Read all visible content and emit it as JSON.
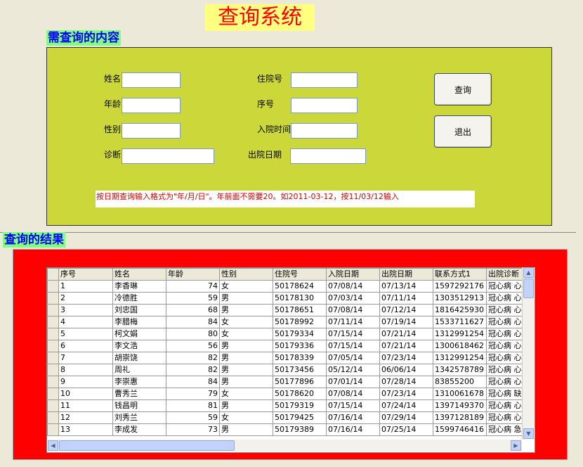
{
  "title": "查询系统",
  "query_section_label": "需查询的内容",
  "result_section_label": "查询的结果",
  "fields": {
    "name": {
      "label": "姓名",
      "value": ""
    },
    "age": {
      "label": "年龄",
      "value": ""
    },
    "gender": {
      "label": "性别",
      "value": ""
    },
    "diagnosis": {
      "label": "诊断",
      "value": ""
    },
    "admission_no": {
      "label": "住院号",
      "value": ""
    },
    "seq": {
      "label": "序号",
      "value": ""
    },
    "admit_time": {
      "label": "入院时间",
      "value": ""
    },
    "discharge_date": {
      "label": "出院日期",
      "value": ""
    }
  },
  "buttons": {
    "query": "查询",
    "exit": "退出"
  },
  "note": "按日期查询输入格式为\"年/月/日\"。年前面不需要20。如2011-03-12，按11/03/12输入",
  "table": {
    "columns": [
      "序号",
      "姓名",
      "年龄",
      "性别",
      "住院号",
      "入院日期",
      "出院日期",
      "联系方式1",
      "出院诊断"
    ],
    "rows": [
      [
        "1",
        "李香琳",
        "74",
        "女",
        "50178624",
        "07/08/14",
        "07/13/14",
        "1597292176",
        "冠心病 心"
      ],
      [
        "2",
        "冷德胜",
        "59",
        "男",
        "50178130",
        "07/03/14",
        "07/11/14",
        "1303512913",
        "冠心病 心"
      ],
      [
        "3",
        "刘忠国",
        "68",
        "男",
        "50178651",
        "07/08/14",
        "07/12/14",
        "1816425930",
        "冠心病 心"
      ],
      [
        "4",
        "李腊梅",
        "84",
        "女",
        "50178992",
        "07/11/14",
        "07/19/14",
        "1533711627",
        "冠心病 心"
      ],
      [
        "5",
        "柯文娟",
        "80",
        "女",
        "50179334",
        "07/15/14",
        "07/21/14",
        "1312991254",
        "冠心病 心"
      ],
      [
        "6",
        "李文浩",
        "56",
        "男",
        "50179336",
        "07/15/14",
        "07/21/14",
        "1300618462",
        "冠心病 心"
      ],
      [
        "7",
        "胡崇饶",
        "82",
        "男",
        "50178339",
        "07/05/14",
        "07/23/14",
        "1312991254",
        "冠心病 心"
      ],
      [
        "8",
        "周礼",
        "82",
        "男",
        "50173456",
        "05/12/14",
        "06/06/14",
        "1342578789",
        "冠心病 心"
      ],
      [
        "9",
        "李崇惠",
        "84",
        "男",
        "50177896",
        "07/01/14",
        "07/28/14",
        "83855200",
        "冠心病 心"
      ],
      [
        "10",
        "曹秀兰",
        "79",
        "女",
        "50178620",
        "07/08/14",
        "07/23/14",
        "1310061678",
        "冠心病 缺"
      ],
      [
        "11",
        "钱昌明",
        "81",
        "男",
        "50179319",
        "07/15/14",
        "07/24/14",
        "1397149370",
        "冠心病 心"
      ],
      [
        "12",
        "刘秀兰",
        "59",
        "女",
        "50179425",
        "07/16/14",
        "07/29/14",
        "1397128189",
        "冠心病 心"
      ],
      [
        "13",
        "李成发",
        "73",
        "男",
        "50179389",
        "07/16/14",
        "07/25/14",
        "1599746416",
        "冠心病 急"
      ]
    ]
  }
}
